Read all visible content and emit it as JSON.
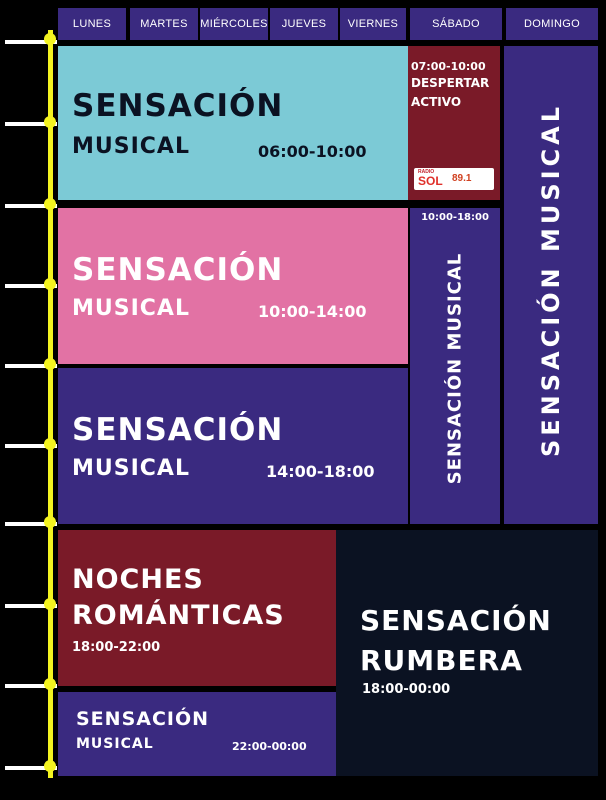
{
  "days": [
    "LUNES",
    "MARTES",
    "MIÉRCOLES",
    "JUEVES",
    "VIERNES",
    "SÁBADO",
    "DOMINGO"
  ],
  "colors": {
    "teal": "#7ccad6",
    "pink": "#e272a4",
    "purple": "#3a2a80",
    "maroon": "#7a1a28",
    "navy": "#0b1222",
    "timeline": "#f3f320"
  },
  "blocks": {
    "morning": {
      "title": "SENSACIÓN",
      "subtitle": "MUSICAL",
      "time": "06:00-10:00"
    },
    "despertar": {
      "time": "07:00-10:00",
      "line1": "DESPERTAR",
      "line2": "ACTIVO",
      "logo_top": "RADIO",
      "logo_main": "SOL",
      "logo_freq": "89.1"
    },
    "midday": {
      "title": "SENSACIÓN",
      "subtitle": "MUSICAL",
      "time": "10:00-14:00"
    },
    "afternoon": {
      "title": "SENSACIÓN",
      "subtitle": "MUSICAL",
      "time": "14:00-18:00"
    },
    "saturday": {
      "time": "10:00-18:00",
      "label": "SENSACIÓN MUSICAL"
    },
    "sunday": {
      "label": "SENSACIÓN MUSICAL"
    },
    "noches": {
      "line1": "NOCHES",
      "line2": "ROMÁNTICAS",
      "time": "18:00-22:00"
    },
    "rumbera": {
      "line1": "SENSACIÓN",
      "line2": "RUMBERA",
      "time": "18:00-00:00"
    },
    "night": {
      "title": "SENSACIÓN",
      "subtitle": "MUSICAL",
      "time": "22:00-00:00"
    }
  }
}
